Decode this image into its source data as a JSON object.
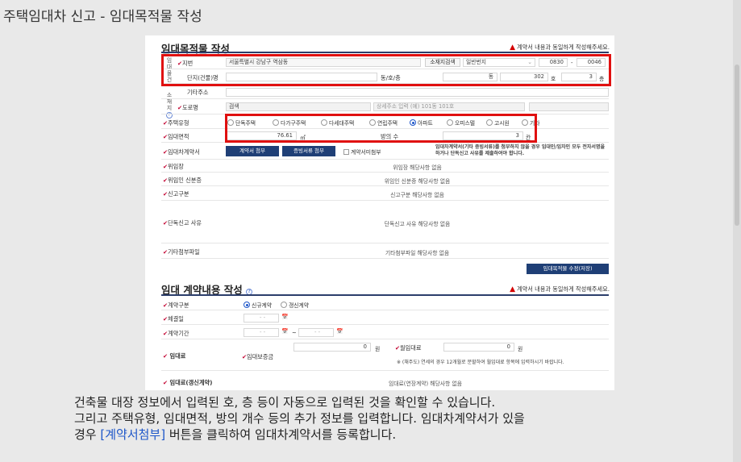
{
  "header": {
    "title": "주택임대차 신고 - 임대목적물 작성"
  },
  "section1": {
    "title": "임대목적물 작성",
    "warning": "계약서 내용과 동일하게 작성해주세요.",
    "side_label_top": [
      "임",
      "대",
      "물",
      "건"
    ],
    "side_label_bottom": [
      "소",
      "재",
      "지"
    ],
    "jibun_label": "지번",
    "jibun_value": "서울특별시 강남구 역삼동",
    "location_search_button": "소재지검색",
    "lot_type": "일반번지",
    "lot_main": "0830",
    "lot_dash": "-",
    "lot_sub": "0046",
    "complex_label": "단지(건물)명",
    "dong_ho_floor_label": "동/호/층",
    "dong_unit": "동",
    "ho_value": "302",
    "ho_unit": "호",
    "floor_value": "3",
    "floor_unit": "층",
    "other_address_label": "기타주소",
    "road_label": "도로명",
    "road_search_button": "검색",
    "road_detail_placeholder": "상세주소 입력 (예) 101동 101호",
    "housing_type_label": "주택유형",
    "housing_types": [
      "단독주택",
      "다가구주택",
      "다세대주택",
      "연립주택",
      "아파트",
      "오피스텔",
      "고시원",
      "기타"
    ],
    "housing_type_selected": "아파트",
    "area_label": "임대면적",
    "area_value": "76.61",
    "area_unit": "㎡",
    "room_count_label": "방의 수",
    "room_count_value": "3",
    "room_count_unit": "칸",
    "contract_label": "임대차계약서",
    "contract_attach_button": "계약서 첨부",
    "evidence_attach_button": "증빙서류 첨부",
    "no_contract_checkbox": "계약서미첨부",
    "contract_notice": "임대차계약서(기타 증빙서류)를 첨부하지 않을 경우 임대인/임차인 모두 전자서명을 하거나 단독신고 사유를 제출하여야 합니다.",
    "delegation_label": "위임장",
    "delegation_value": "위임장 해당사항 없음",
    "delegate_id_label": "위임인 신분증",
    "delegate_id_value": "위임인 신분증 해당사항 없음",
    "report_type_label": "신고구분",
    "report_type_value": "신고구분 해당사항 없음",
    "sole_reason_label": "단독신고 사유",
    "sole_reason_value": "단독신고 사유 해당사항 없음",
    "other_attach_label": "기타첨부파일",
    "other_attach_value": "기타첨부파일 해당사항 없음",
    "save_button": "임대목적물 수정(저장)"
  },
  "section2": {
    "title": "임대 계약내용 작성",
    "warning": "계약서 내용과 동일하게 작성해주세요.",
    "contract_type_label": "계약구분",
    "contract_types": [
      "신규계약",
      "갱신계약"
    ],
    "contract_type_selected": "신규계약",
    "sign_date_label": "체결일",
    "date_placeholder": "-   -",
    "period_label": "계약기간",
    "period_sep": "~",
    "rent_label": "임대료",
    "deposit_label": "임대보증금",
    "deposit_value": "0",
    "won": "원",
    "monthly_label": "월임대료",
    "monthly_value": "0",
    "monthly_notice": "※ (채주도) 연세의 경우 12개월로 분할하여 월임대료 항목에 입력하시기 바랍니다.",
    "renewal_label": "임대료(갱신계약)",
    "renewal_value": "임대료(연장계약) 해당사항 없음"
  },
  "caption": {
    "line1": "건축물 대장 정보에서 입력된 호, 층 등이 자동으로 입력된 것을 확인할 수 있습니다.",
    "line2": "그리고 주택유형, 임대면적, 방의 개수 등의 추가 정보를 입력합니다. 임대차계약서가 있을",
    "line3_prefix": "경우 ",
    "line3_link": "[계약서첨부]",
    "line3_suffix": " 버튼을 클릭하여 임대차계약서를 등록합니다."
  }
}
